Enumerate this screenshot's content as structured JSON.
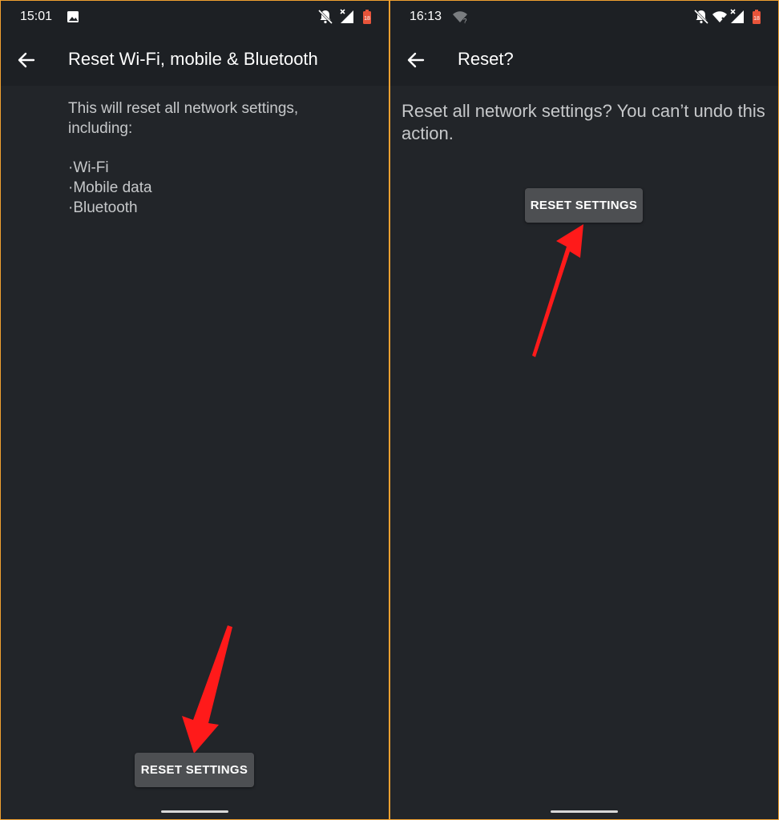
{
  "left": {
    "status": {
      "time": "15:01"
    },
    "title": "Reset Wi-Fi, mobile & Bluetooth",
    "description": "This will reset all network settings, including:",
    "bullets": [
      "Wi-Fi",
      "Mobile data",
      "Bluetooth"
    ],
    "button_label": "RESET SETTINGS"
  },
  "right": {
    "status": {
      "time": "16:13"
    },
    "title": "Reset?",
    "description": "Reset all network settings? You can’t undo this action.",
    "button_label": "RESET SETTINGS"
  },
  "colors": {
    "background": "#222529",
    "app_bar": "#1d2024",
    "button": "#4d4f52",
    "annotation_arrow": "#ff1a1a",
    "panel_border": "#f0a030"
  },
  "icons": {
    "status_left": [
      "image-icon",
      "notifications-off-icon",
      "signal-no-service-icon",
      "battery-saver-icon"
    ],
    "status_right": [
      "wifi-question-icon",
      "notifications-off-icon",
      "wifi-icon",
      "signal-no-service-icon",
      "battery-saver-icon"
    ],
    "app_bar": [
      "back-arrow-icon"
    ]
  }
}
